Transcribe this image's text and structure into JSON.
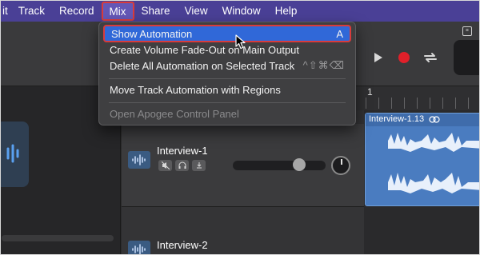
{
  "menubar": {
    "items": [
      {
        "label": "it"
      },
      {
        "label": "Track"
      },
      {
        "label": "Record"
      },
      {
        "label": "Mix"
      },
      {
        "label": "Share"
      },
      {
        "label": "View"
      },
      {
        "label": "Window"
      },
      {
        "label": "Help"
      }
    ],
    "active_item": "Mix"
  },
  "mix_menu": {
    "items": [
      {
        "label": "Show Automation",
        "shortcut": "A",
        "highlighted": true,
        "enabled": true
      },
      {
        "label": "Create Volume Fade-Out on Main Output",
        "shortcut": "",
        "enabled": true
      },
      {
        "label": "Delete All Automation on Selected Track",
        "shortcut": "^⇧⌘⌫",
        "enabled": true
      },
      {
        "label": "Move Track Automation with Regions",
        "shortcut": "",
        "enabled": true
      },
      {
        "label": "Open Apogee Control Panel",
        "shortcut": "",
        "enabled": false
      }
    ]
  },
  "ruler": {
    "bar": "1"
  },
  "tracks": [
    {
      "name": "Interview-1"
    },
    {
      "name": "Interview-2"
    }
  ],
  "region": {
    "name": "Interview-1.13"
  },
  "icons": {
    "play": "play-icon",
    "record": "record-icon",
    "cycle": "cycle-icon",
    "mute": "mute-icon",
    "headphones": "headphones-icon",
    "input": "input-monitor-icon",
    "waveform": "audio-track-icon"
  },
  "colors": {
    "menubar": "#4a4096",
    "highlight": "#3068d8",
    "annotation": "#d93b3b",
    "region": "#4a7cc0",
    "record": "#e0202a"
  }
}
